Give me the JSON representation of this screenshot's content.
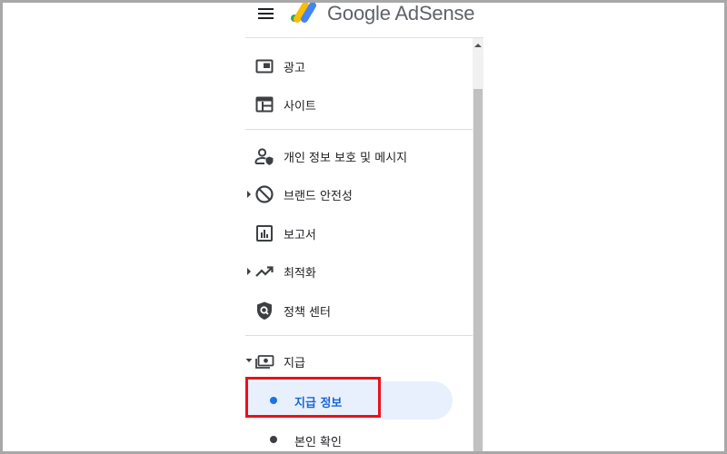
{
  "header": {
    "brand_name": "Google AdSense",
    "menu_icon": "hamburger-menu-icon",
    "logo_icon": "adsense-logo-icon",
    "colors": {
      "logo_yellow": "#fbbc04",
      "logo_blue": "#4285f4",
      "logo_green": "#34a853"
    }
  },
  "nav": {
    "items": [
      {
        "label": "광고",
        "icon": "ads-icon"
      },
      {
        "label": "사이트",
        "icon": "sites-icon"
      },
      {
        "label": "개인 정보 보호 및 메시지",
        "icon": "privacy-messaging-icon"
      },
      {
        "label": "브랜드 안전성",
        "icon": "block-icon",
        "expandable": true,
        "expanded": false
      },
      {
        "label": "보고서",
        "icon": "reports-icon"
      },
      {
        "label": "최적화",
        "icon": "trending-up-icon",
        "expandable": true,
        "expanded": false
      },
      {
        "label": "정책 센터",
        "icon": "policy-shield-icon"
      },
      {
        "label": "지급",
        "icon": "payments-icon",
        "expandable": true,
        "expanded": true
      }
    ],
    "sub_items": [
      {
        "label": "지급 정보",
        "active": true
      },
      {
        "label": "본인 확인",
        "active": false
      }
    ]
  },
  "colors": {
    "active_background": "#e8f0fe",
    "active_text": "#1967d2",
    "highlight_border": "#e8121d",
    "frame_border": "#a8a8a8"
  }
}
